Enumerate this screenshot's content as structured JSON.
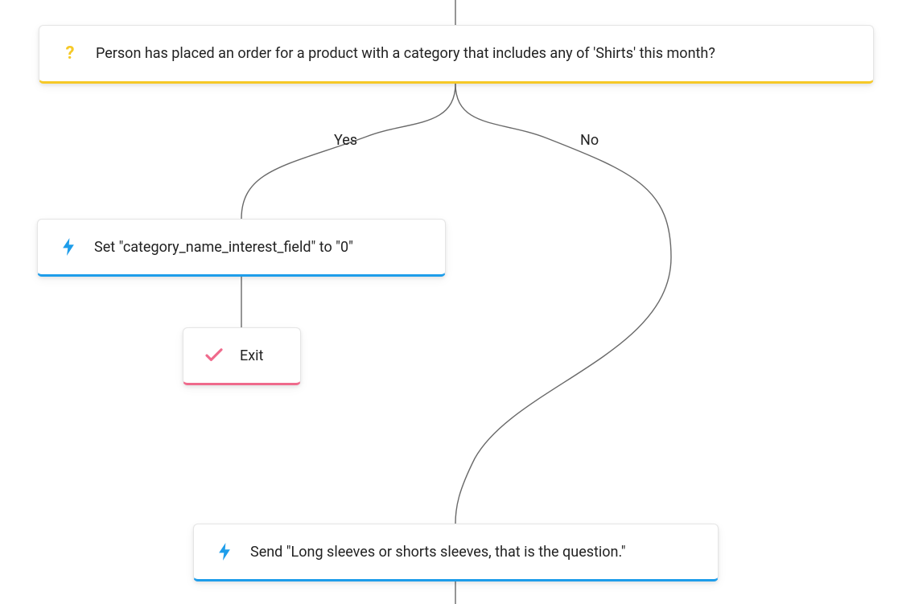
{
  "colors": {
    "accent_yellow": "#f6c927",
    "accent_blue": "#1e9dea",
    "accent_pink": "#ef6a8c"
  },
  "branches": {
    "yes": "Yes",
    "no": "No"
  },
  "nodes": {
    "condition": {
      "icon_glyph": "?",
      "label": "Person has placed an order for a product with a category that includes any of 'Shirts' this month?"
    },
    "set_field": {
      "label": "Set \"category_name_interest_field\" to \"0\""
    },
    "exit": {
      "label": "Exit"
    },
    "send": {
      "label": "Send \"Long sleeves or shorts sleeves, that is the question.\""
    }
  }
}
